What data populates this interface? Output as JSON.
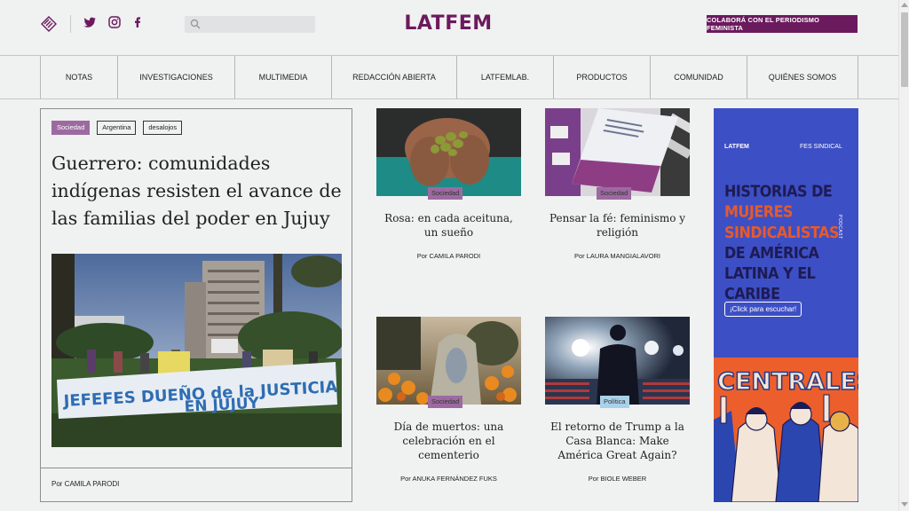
{
  "header": {
    "logo_icon": "latfem-logo-icon",
    "social": [
      "twitter-icon",
      "instagram-icon",
      "facebook-icon"
    ],
    "search_placeholder": "",
    "brand": "LATFEM",
    "cta_label": "COLABORÁ CON EL PERIODISMO FEMINISTA",
    "brand_color": "#6b1a5e"
  },
  "nav": {
    "items": [
      {
        "label": "NOTAS"
      },
      {
        "label": "INVESTIGACIONES"
      },
      {
        "label": "MULTIMEDIA"
      },
      {
        "label": "REDACCIÓN ABIERTA"
      },
      {
        "label": "LATFEMLAB."
      },
      {
        "label": "PRODUCTOS"
      },
      {
        "label": "COMUNIDAD"
      },
      {
        "label": "QUIÉNES SOMOS"
      }
    ]
  },
  "featured": {
    "tags": [
      "Sociedad",
      "Argentina",
      "desalojos"
    ],
    "title": "Guerrero: comunidades indígenas resisten el avance de las familias del poder en Jujuy",
    "banner_text_1": "JEFEFES DUEÑO de la JUSTICIA",
    "banner_text_2": "EN JUJUY",
    "author": "Por CAMILA PARODI"
  },
  "cards": [
    {
      "category": "Sociedad",
      "title": "Rosa: en cada aceituna, un sueño",
      "author": "Por CAMILA PARODI"
    },
    {
      "category": "Sociedad",
      "title": "Pensar la fé: feminismo y religión",
      "author": "Por LAURA MANGIALAVORI"
    },
    {
      "category": "Sociedad",
      "title": "Día de muertos: una celebración en el cementerio",
      "author": "Por ANUKA FERNÁNDEZ FUKS"
    },
    {
      "category": "Política",
      "title": "El retorno de Trump a la Casa Blanca: Make América Great Again?",
      "author": "Por BIOLE WEBER"
    }
  ],
  "ad": {
    "logo_left": "LATFEM",
    "logo_right": "FES SINDICAL",
    "title_1": "HISTORIAS DE",
    "title_2": "MUJERES SINDICALISTAS",
    "title_3": "DE AMÉRICA LATINA Y EL CARIBE",
    "podcast": "PODCAST",
    "button": "¡Click para escuchar!",
    "poster_word": "CENTRALES"
  },
  "colors": {
    "sociedad": "#9c6aa0",
    "politica": "#a9d1ea",
    "ad_blue": "#3d4fc4",
    "ad_orange": "#ec5f2c"
  }
}
